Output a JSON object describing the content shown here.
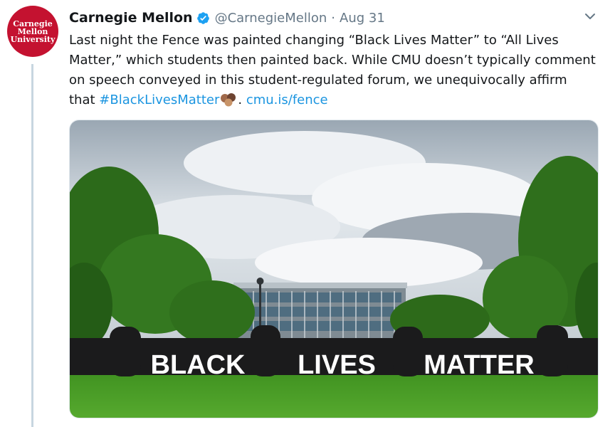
{
  "tweet": {
    "avatar_lines": [
      "Carnegie",
      "Mellon",
      "University"
    ],
    "author_name": "Carnegie Mellon",
    "verified_icon": "verified-badge-icon",
    "handle": "@CarnegieMellon",
    "separator": "·",
    "date": "Aug 31",
    "menu_icon": "chevron-down-icon",
    "text_main": "Last night the Fence was painted changing “Black Lives Matter” to “All Lives Matter,” which students then painted back. While CMU doesn’t typically comment on speech conveyed in this student-regulated forum, we unequivocally affirm that ",
    "hashtag": "#BlackLivesMatter",
    "emoji_icon": "raised-fists-emoji",
    "text_after": ". ",
    "link": "cmu.is/fence",
    "photo": {
      "fence_words": [
        "BLACK",
        "LIVES",
        "MATTER"
      ]
    }
  },
  "colors": {
    "brand": "#c41230",
    "link": "#1b95e0",
    "muted": "#657786",
    "thread_line": "#c7d6e0"
  }
}
